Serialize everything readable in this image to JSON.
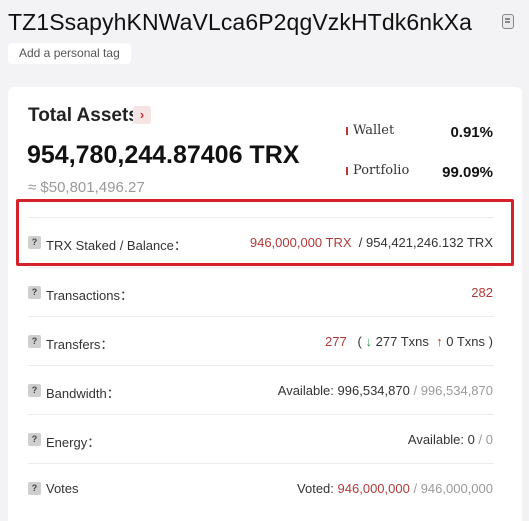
{
  "header": {
    "address": "TZ1SsapyhKNWaVLca6P2qgVzkHTdk6nkXa",
    "tag_button": "Add a personal tag"
  },
  "total_assets": {
    "title": "Total Assets",
    "amount": "954,780,244.87406 TRX",
    "usd": "≈ $50,801,496.27",
    "legend": [
      {
        "label": "Wallet",
        "percent": "0.91%",
        "color": "#c23631"
      },
      {
        "label": "Portfolio",
        "percent": "99.09%",
        "color": "#c23631"
      }
    ]
  },
  "rows": {
    "staked": {
      "label": "TRX Staked / Balance",
      "staked": "946,000,000 TRX",
      "sep": "/",
      "balance": "954,421,246.132 TRX"
    },
    "transactions": {
      "label": "Transactions",
      "value": "282"
    },
    "transfers": {
      "label": "Transfers",
      "total": "277",
      "open": "(",
      "in_txns": "277 Txns",
      "out_txns": "0 Txns",
      "close": ")"
    },
    "bandwidth": {
      "label": "Bandwidth",
      "prefix": "Available:",
      "available": "996,534,870",
      "sep": "/",
      "total": "996,534,870"
    },
    "energy": {
      "label": "Energy",
      "prefix": "Available:",
      "available": "0",
      "sep": "/",
      "total": "0"
    },
    "votes": {
      "label": "Votes",
      "prefix": "Voted:",
      "voted": "946,000,000",
      "sep": "/",
      "total": "946,000,000"
    }
  },
  "colors": {
    "accent_red": "#c23631",
    "highlight_border": "#d4222b"
  }
}
